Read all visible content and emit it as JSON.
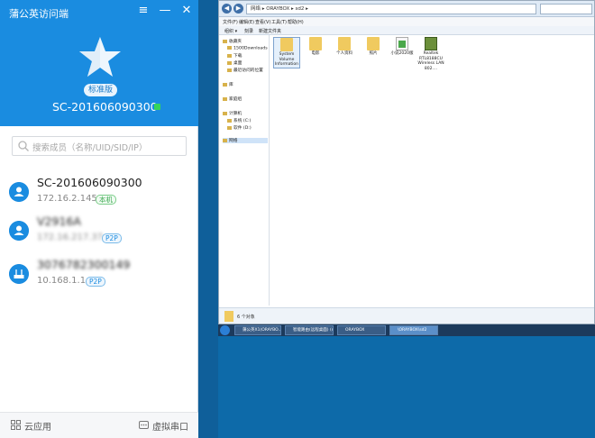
{
  "app": {
    "title": "蒲公英访问端",
    "edition": "标准版",
    "host_name": "SC-201606090300",
    "search": {
      "placeholder": "搜索成员（名称/UID/SID/IP）"
    },
    "devices": [
      {
        "name": "SC-201606090300",
        "ip": "172.16.2.145",
        "badge": "本机",
        "badge_color": "green",
        "icon": "monitor-icon",
        "blurred": false
      },
      {
        "name": "V2916A",
        "ip": "172.16.217.37",
        "badge": "P2P",
        "badge_color": "blue",
        "icon": "monitor-icon",
        "blurred": true
      },
      {
        "name": "3076782300149",
        "ip": "10.168.1.1",
        "badge": "P2P",
        "badge_color": "blue",
        "icon": "router-icon",
        "blurred": true
      }
    ],
    "footer": {
      "cloud_apps": "云应用",
      "virtual_serial": "虚拟串口"
    },
    "colors": {
      "primary": "#1a8ce0",
      "online": "#35d45a"
    }
  },
  "remote": {
    "address": "网络 ▸ ORAYBOX ▸ sd2 ▸",
    "menu": [
      "文件(F)",
      "编辑(E)",
      "查看(V)",
      "工具(T)",
      "帮助(H)"
    ],
    "toolbar": [
      "组织 ▾",
      "刻录",
      "新建文件夹"
    ],
    "nav": {
      "favorites": "收藏夹",
      "fav_items": [
        "1500Downloads",
        "下载",
        "桌面",
        "最近访问的位置"
      ],
      "libraries": "库",
      "homegroup": "家庭组",
      "computer": "计算机",
      "drives": [
        "系统 (C:)",
        "软件 (D:)"
      ],
      "network": "网络"
    },
    "files": [
      {
        "name": "System Volume Information",
        "kind": "folder"
      },
      {
        "name": "电影",
        "kind": "folder"
      },
      {
        "name": "个人资料",
        "kind": "folder"
      },
      {
        "name": "照片",
        "kind": "folder"
      },
      {
        "name": "小说2020版",
        "kind": "document"
      },
      {
        "name": "Realtek RTL8188CU Wireless LAN 802....",
        "kind": "installer"
      }
    ],
    "status": "6 个对象",
    "taskbar": [
      "蒲公英X1(ORAYBO...",
      "智能路由(远程桌面) (n...",
      "ORAYBOX",
      "\\ORAYBOX\\sd2"
    ]
  }
}
